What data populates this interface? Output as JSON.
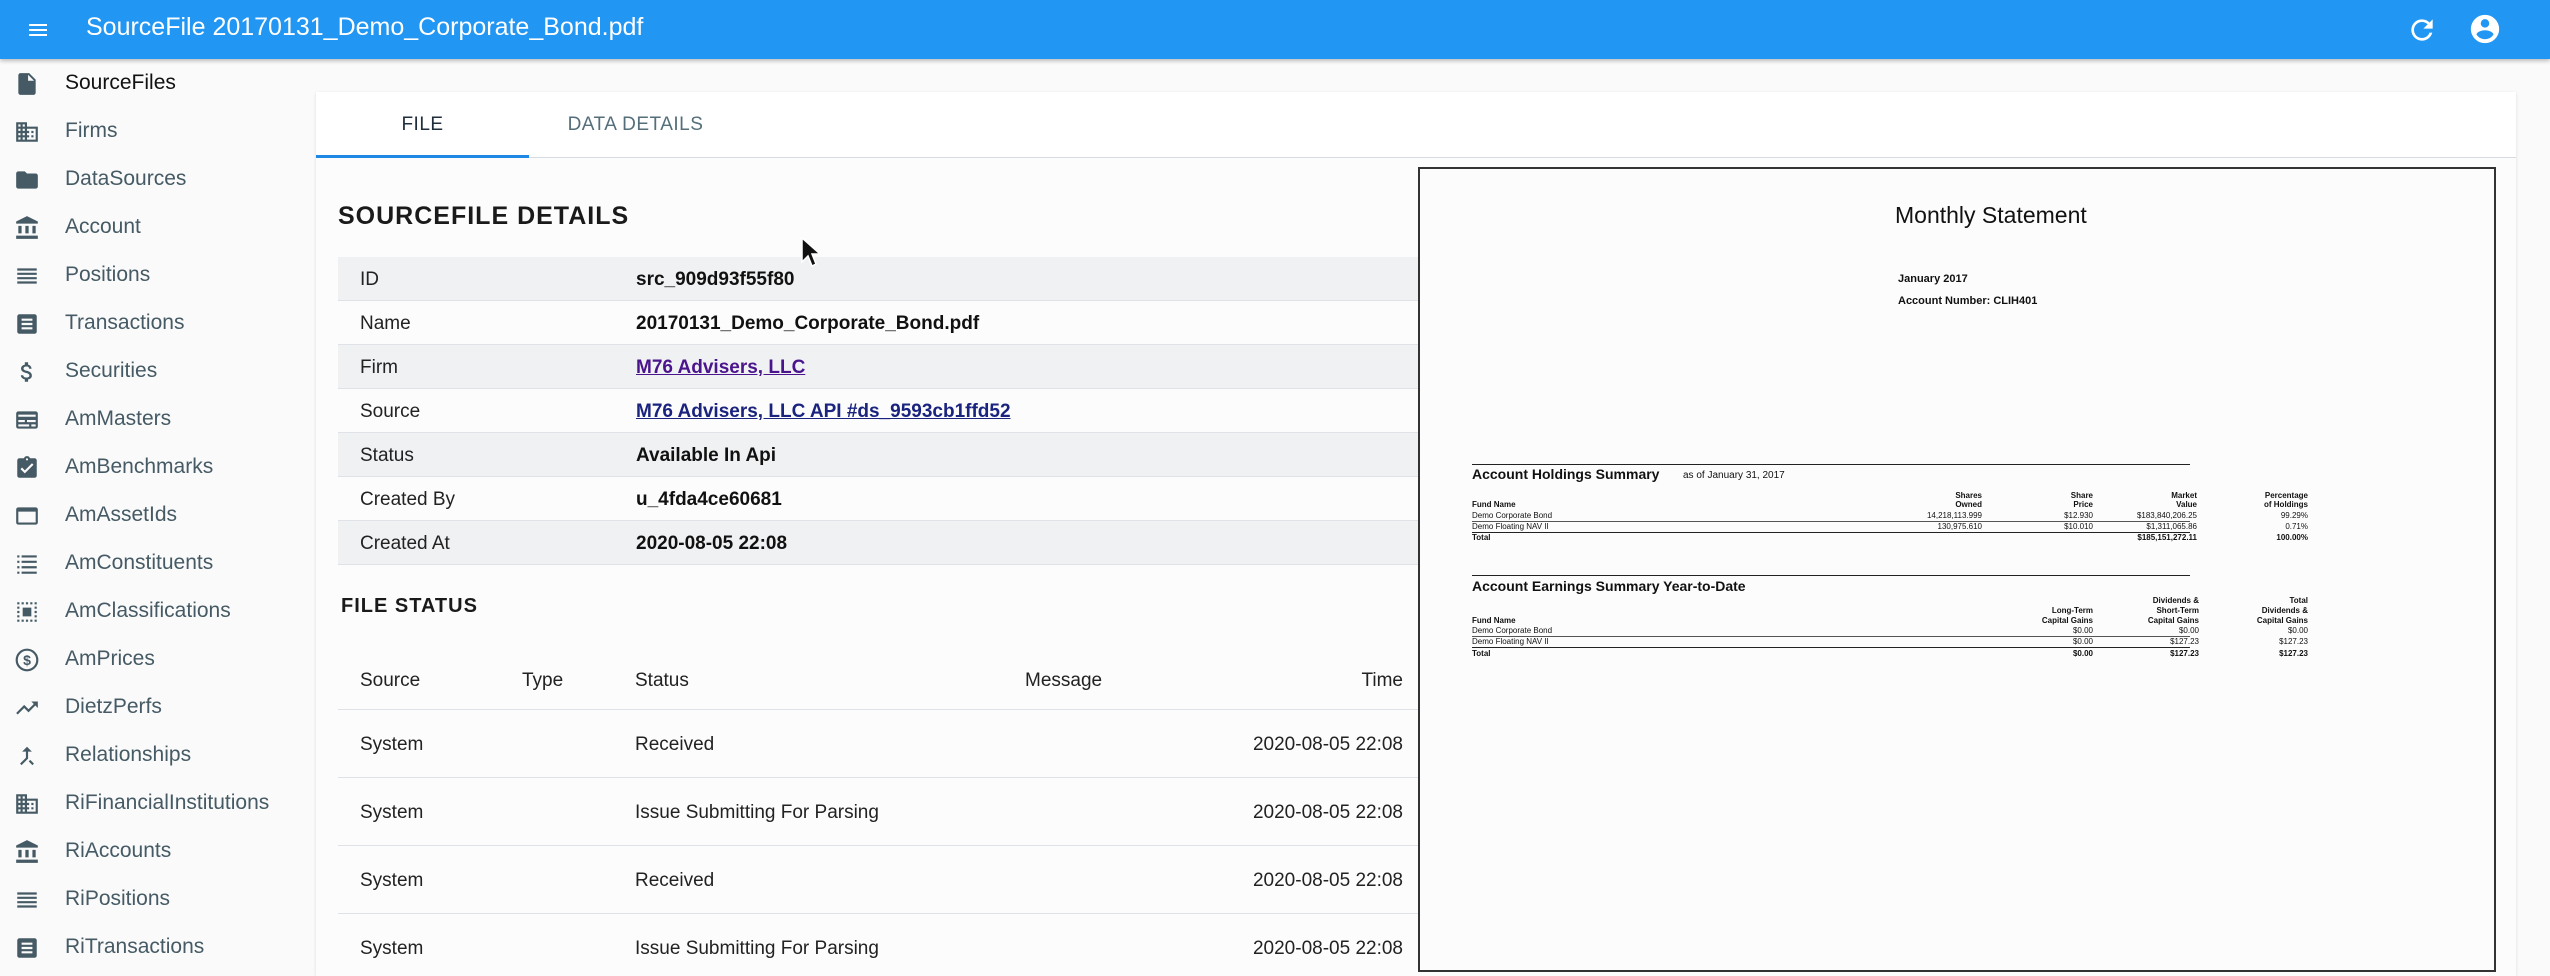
{
  "appbar": {
    "title": "SourceFile 20170131_Demo_Corporate_Bond.pdf"
  },
  "sidebar": {
    "items": [
      {
        "label": "SourceFiles",
        "icon": "file-icon"
      },
      {
        "label": "Firms",
        "icon": "building-icon"
      },
      {
        "label": "DataSources",
        "icon": "folder-icon"
      },
      {
        "label": "Account",
        "icon": "bank-icon"
      },
      {
        "label": "Positions",
        "icon": "list-icon"
      },
      {
        "label": "Transactions",
        "icon": "receipt-icon"
      },
      {
        "label": "Securities",
        "icon": "dollar-icon"
      },
      {
        "label": "AmMasters",
        "icon": "card-icon"
      },
      {
        "label": "AmBenchmarks",
        "icon": "clipboard-check-icon"
      },
      {
        "label": "AmAssetIds",
        "icon": "window-icon"
      },
      {
        "label": "AmConstituents",
        "icon": "list-lines-icon"
      },
      {
        "label": "AmClassifications",
        "icon": "select-box-icon"
      },
      {
        "label": "AmPrices",
        "icon": "dollar-circle-icon"
      },
      {
        "label": "DietzPerfs",
        "icon": "trending-up-icon"
      },
      {
        "label": "Relationships",
        "icon": "merge-icon"
      },
      {
        "label": "RiFinancialInstitutions",
        "icon": "building-icon"
      },
      {
        "label": "RiAccounts",
        "icon": "bank-icon"
      },
      {
        "label": "RiPositions",
        "icon": "list-icon"
      },
      {
        "label": "RiTransactions",
        "icon": "receipt-icon"
      }
    ]
  },
  "tabs": {
    "file": "FILE",
    "data_details": "DATA DETAILS"
  },
  "details": {
    "title": "SOURCEFILE DETAILS",
    "rows": [
      {
        "key": "ID",
        "value": "src_909d93f55f80"
      },
      {
        "key": "Name",
        "value": "20170131_Demo_Corporate_Bond.pdf"
      },
      {
        "key": "Firm",
        "value": "M76 Advisers, LLC"
      },
      {
        "key": "Source",
        "value": "M76 Advisers, LLC API #ds_9593cb1ffd52"
      },
      {
        "key": "Status",
        "value": "Available In Api"
      },
      {
        "key": "Created By",
        "value": "u_4fda4ce60681"
      },
      {
        "key": "Created At",
        "value": "2020-08-05 22:08"
      }
    ]
  },
  "file_status": {
    "title": "FILE STATUS",
    "headers": {
      "source": "Source",
      "type": "Type",
      "status": "Status",
      "message": "Message",
      "time": "Time"
    },
    "rows": [
      {
        "source": "System",
        "type": "",
        "status": "Received",
        "message": "",
        "time": "2020-08-05 22:08"
      },
      {
        "source": "System",
        "type": "",
        "status": "Issue Submitting For Parsing",
        "message": "",
        "time": "2020-08-05 22:08"
      },
      {
        "source": "System",
        "type": "",
        "status": "Received",
        "message": "",
        "time": "2020-08-05 22:08"
      },
      {
        "source": "System",
        "type": "",
        "status": "Issue Submitting For Parsing",
        "message": "",
        "time": "2020-08-05 22:08"
      }
    ]
  },
  "pdf": {
    "title": "Monthly Statement",
    "month": "January 2017",
    "account_number": "Account Number: CLIH401",
    "holdings": {
      "title": "Account Holdings Summary",
      "as_of": "as of January 31, 2017",
      "headers": {
        "fund": "Fund Name",
        "shares_1": "Shares",
        "shares_2": "Owned",
        "price_1": "Share",
        "price_2": "Price",
        "mv_1": "Market",
        "mv_2": "Value",
        "pct_1": "Percentage",
        "pct_2": "of Holdings"
      },
      "rows": [
        {
          "fund": "Demo Corporate Bond",
          "shares": "14,218,113.999",
          "price": "$12.930",
          "mv": "$183,840,206.25",
          "pct": "99.29%"
        },
        {
          "fund": "Demo Floating NAV II",
          "shares": "130,975.610",
          "price": "$10.010",
          "mv": "$1,311,065.86",
          "pct": "0.71%"
        }
      ],
      "total": {
        "label": "Total",
        "mv": "$185,151,272.11",
        "pct": "100.00%"
      }
    },
    "earnings": {
      "title": "Account Earnings Summary Year-to-Date",
      "headers": {
        "fund": "Fund Name",
        "lt_1": "Long-Term",
        "lt_2": "Capital Gains",
        "div_1": "Dividends &",
        "div_2": "Short-Term",
        "div_3": "Capital Gains",
        "tot_1": "Total",
        "tot_2": "Dividends &",
        "tot_3": "Capital Gains"
      },
      "rows": [
        {
          "fund": "Demo Corporate Bond",
          "lt": "$0.00",
          "div": "$0.00",
          "tot": "$0.00"
        },
        {
          "fund": "Demo Floating NAV II",
          "lt": "$0.00",
          "div": "$127.23",
          "tot": "$127.23"
        }
      ],
      "total": {
        "label": "Total",
        "lt": "$0.00",
        "div": "$127.23",
        "tot": "$127.23"
      }
    }
  },
  "colors": {
    "appbar": "#2196f3",
    "tab_indicator": "#1e88e5",
    "link": "#1a237e",
    "visited_link": "#4a148c"
  }
}
